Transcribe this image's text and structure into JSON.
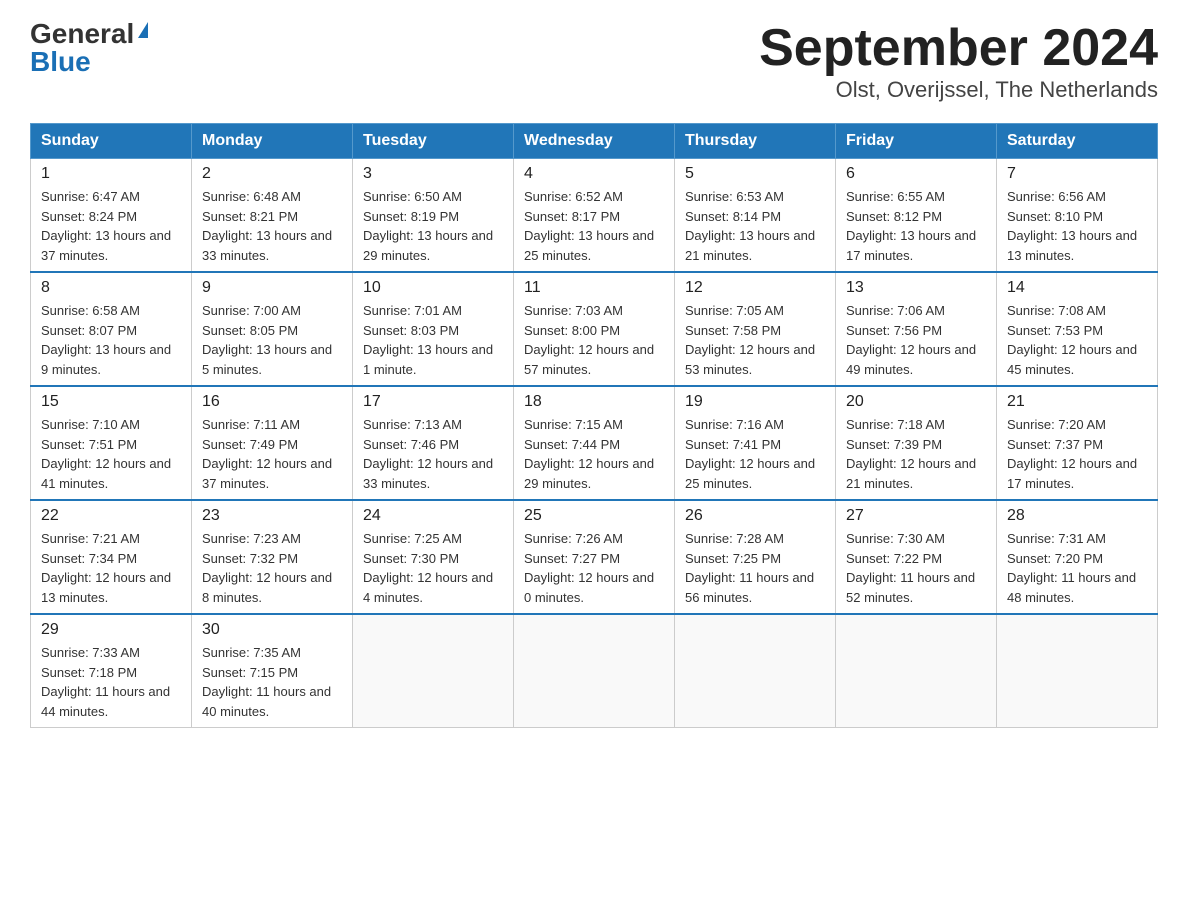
{
  "logo": {
    "general": "General",
    "blue": "Blue"
  },
  "title": "September 2024",
  "subtitle": "Olst, Overijssel, The Netherlands",
  "days_of_week": [
    "Sunday",
    "Monday",
    "Tuesday",
    "Wednesday",
    "Thursday",
    "Friday",
    "Saturday"
  ],
  "weeks": [
    [
      {
        "day": "1",
        "sunrise": "6:47 AM",
        "sunset": "8:24 PM",
        "daylight": "13 hours and 37 minutes."
      },
      {
        "day": "2",
        "sunrise": "6:48 AM",
        "sunset": "8:21 PM",
        "daylight": "13 hours and 33 minutes."
      },
      {
        "day": "3",
        "sunrise": "6:50 AM",
        "sunset": "8:19 PM",
        "daylight": "13 hours and 29 minutes."
      },
      {
        "day": "4",
        "sunrise": "6:52 AM",
        "sunset": "8:17 PM",
        "daylight": "13 hours and 25 minutes."
      },
      {
        "day": "5",
        "sunrise": "6:53 AM",
        "sunset": "8:14 PM",
        "daylight": "13 hours and 21 minutes."
      },
      {
        "day": "6",
        "sunrise": "6:55 AM",
        "sunset": "8:12 PM",
        "daylight": "13 hours and 17 minutes."
      },
      {
        "day": "7",
        "sunrise": "6:56 AM",
        "sunset": "8:10 PM",
        "daylight": "13 hours and 13 minutes."
      }
    ],
    [
      {
        "day": "8",
        "sunrise": "6:58 AM",
        "sunset": "8:07 PM",
        "daylight": "13 hours and 9 minutes."
      },
      {
        "day": "9",
        "sunrise": "7:00 AM",
        "sunset": "8:05 PM",
        "daylight": "13 hours and 5 minutes."
      },
      {
        "day": "10",
        "sunrise": "7:01 AM",
        "sunset": "8:03 PM",
        "daylight": "13 hours and 1 minute."
      },
      {
        "day": "11",
        "sunrise": "7:03 AM",
        "sunset": "8:00 PM",
        "daylight": "12 hours and 57 minutes."
      },
      {
        "day": "12",
        "sunrise": "7:05 AM",
        "sunset": "7:58 PM",
        "daylight": "12 hours and 53 minutes."
      },
      {
        "day": "13",
        "sunrise": "7:06 AM",
        "sunset": "7:56 PM",
        "daylight": "12 hours and 49 minutes."
      },
      {
        "day": "14",
        "sunrise": "7:08 AM",
        "sunset": "7:53 PM",
        "daylight": "12 hours and 45 minutes."
      }
    ],
    [
      {
        "day": "15",
        "sunrise": "7:10 AM",
        "sunset": "7:51 PM",
        "daylight": "12 hours and 41 minutes."
      },
      {
        "day": "16",
        "sunrise": "7:11 AM",
        "sunset": "7:49 PM",
        "daylight": "12 hours and 37 minutes."
      },
      {
        "day": "17",
        "sunrise": "7:13 AM",
        "sunset": "7:46 PM",
        "daylight": "12 hours and 33 minutes."
      },
      {
        "day": "18",
        "sunrise": "7:15 AM",
        "sunset": "7:44 PM",
        "daylight": "12 hours and 29 minutes."
      },
      {
        "day": "19",
        "sunrise": "7:16 AM",
        "sunset": "7:41 PM",
        "daylight": "12 hours and 25 minutes."
      },
      {
        "day": "20",
        "sunrise": "7:18 AM",
        "sunset": "7:39 PM",
        "daylight": "12 hours and 21 minutes."
      },
      {
        "day": "21",
        "sunrise": "7:20 AM",
        "sunset": "7:37 PM",
        "daylight": "12 hours and 17 minutes."
      }
    ],
    [
      {
        "day": "22",
        "sunrise": "7:21 AM",
        "sunset": "7:34 PM",
        "daylight": "12 hours and 13 minutes."
      },
      {
        "day": "23",
        "sunrise": "7:23 AM",
        "sunset": "7:32 PM",
        "daylight": "12 hours and 8 minutes."
      },
      {
        "day": "24",
        "sunrise": "7:25 AM",
        "sunset": "7:30 PM",
        "daylight": "12 hours and 4 minutes."
      },
      {
        "day": "25",
        "sunrise": "7:26 AM",
        "sunset": "7:27 PM",
        "daylight": "12 hours and 0 minutes."
      },
      {
        "day": "26",
        "sunrise": "7:28 AM",
        "sunset": "7:25 PM",
        "daylight": "11 hours and 56 minutes."
      },
      {
        "day": "27",
        "sunrise": "7:30 AM",
        "sunset": "7:22 PM",
        "daylight": "11 hours and 52 minutes."
      },
      {
        "day": "28",
        "sunrise": "7:31 AM",
        "sunset": "7:20 PM",
        "daylight": "11 hours and 48 minutes."
      }
    ],
    [
      {
        "day": "29",
        "sunrise": "7:33 AM",
        "sunset": "7:18 PM",
        "daylight": "11 hours and 44 minutes."
      },
      {
        "day": "30",
        "sunrise": "7:35 AM",
        "sunset": "7:15 PM",
        "daylight": "11 hours and 40 minutes."
      },
      null,
      null,
      null,
      null,
      null
    ]
  ]
}
